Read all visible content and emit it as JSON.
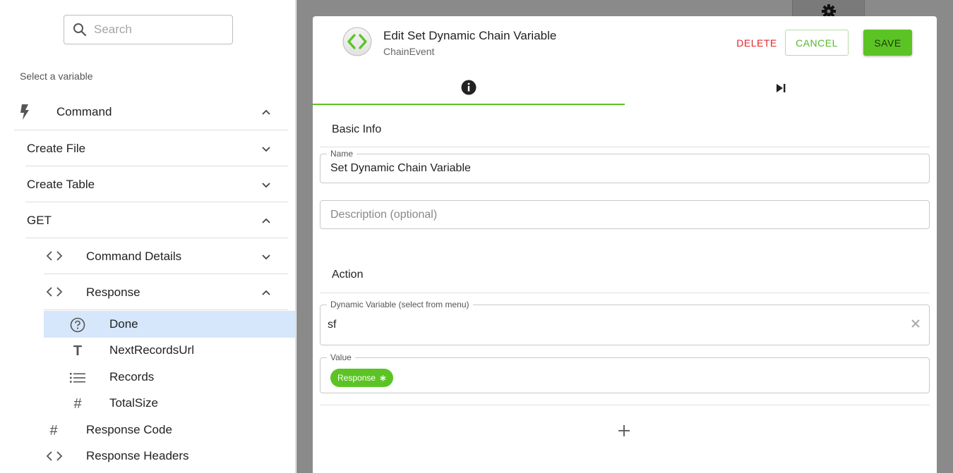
{
  "sidebar": {
    "search_placeholder": "Search",
    "select_label": "Select a variable",
    "items": [
      {
        "label": "Command",
        "icon": "bolt-icon",
        "expanded": true
      },
      {
        "label": "Create File",
        "expanded": false
      },
      {
        "label": "Create Table",
        "expanded": false
      },
      {
        "label": "GET",
        "expanded": true
      },
      {
        "label": "Command Details",
        "icon": "code-icon",
        "expanded": false
      },
      {
        "label": "Response",
        "icon": "code-icon",
        "expanded": true
      },
      {
        "label": "Done",
        "icon": "question-circle-icon",
        "selected": true
      },
      {
        "label": "NextRecordsUrl",
        "icon": "text-type-icon"
      },
      {
        "label": "Records",
        "icon": "list-icon"
      },
      {
        "label": "TotalSize",
        "icon": "hash-icon"
      },
      {
        "label": "Response Code",
        "icon": "hash-icon"
      },
      {
        "label": "Response Headers",
        "icon": "code-icon"
      }
    ]
  },
  "dialog": {
    "title": "Edit Set Dynamic Chain Variable",
    "subtitle": "ChainEvent",
    "delete_label": "DELETE",
    "cancel_label": "CANCEL",
    "save_label": "SAVE",
    "basic_info_heading": "Basic Info",
    "name_label": "Name",
    "name_value": "Set Dynamic Chain Variable",
    "description_placeholder": "Description (optional)",
    "action_heading": "Action",
    "dynamic_variable_label": "Dynamic Variable (select from menu)",
    "dynamic_variable_value": "sf",
    "value_label": "Value",
    "value_chip": "Response"
  },
  "colors": {
    "accent_green": "#5bc424",
    "delete_red": "#e0252b",
    "selected_row": "#d6e6fb"
  }
}
